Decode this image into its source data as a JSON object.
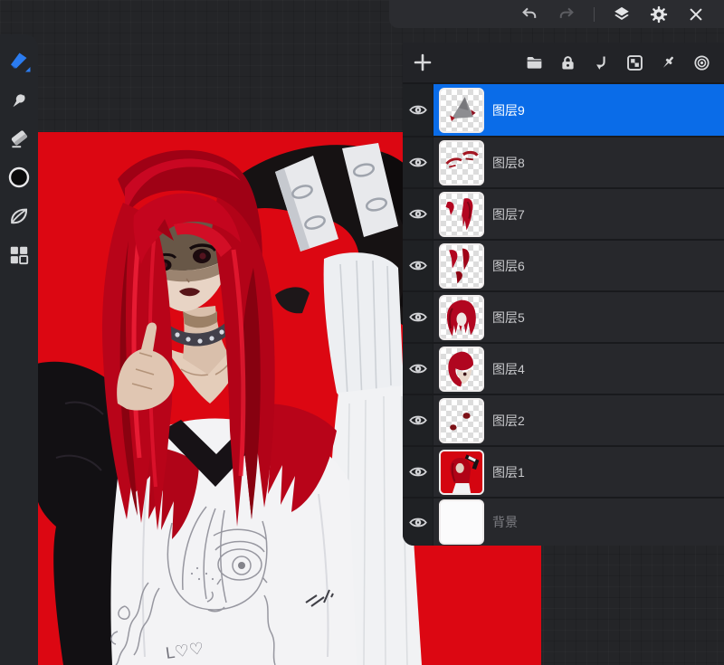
{
  "colors": {
    "accent_blue": "#0a6ce8",
    "canvas_red": "#dc0712",
    "panel_bg": "#232428",
    "row_bg": "#27282c",
    "current_color_swatch": "#0b0b0c"
  },
  "top_toolbar": {
    "items": [
      {
        "name": "undo",
        "icon": "undo",
        "enabled": true
      },
      {
        "name": "redo",
        "icon": "redo",
        "enabled": false
      },
      {
        "type": "separator"
      },
      {
        "name": "layers-toggle",
        "icon": "layers",
        "enabled": true
      },
      {
        "name": "settings",
        "icon": "gear",
        "enabled": true
      },
      {
        "name": "close",
        "icon": "close",
        "enabled": true
      }
    ]
  },
  "left_toolbar": {
    "tools": [
      {
        "name": "brush-tool",
        "icon": "brush",
        "selected": true
      },
      {
        "name": "smudge-tool",
        "icon": "smudge",
        "selected": false
      },
      {
        "name": "eraser-tool",
        "icon": "eraser",
        "selected": false
      },
      {
        "name": "color-swatch",
        "icon": "color-circle",
        "selected": false,
        "color": "#0b0b0c"
      },
      {
        "name": "leaf-tool",
        "icon": "leaf",
        "selected": false
      },
      {
        "name": "tools-grid",
        "icon": "grid",
        "selected": false
      }
    ]
  },
  "layers_panel": {
    "header": {
      "left_buttons": [
        {
          "name": "add-layer",
          "icon": "plus"
        }
      ],
      "right_buttons": [
        {
          "name": "group-folder",
          "icon": "folder"
        },
        {
          "name": "lock-layer",
          "icon": "lock"
        },
        {
          "name": "clipping-mask",
          "icon": "clip-arrow"
        },
        {
          "name": "alpha-lock",
          "icon": "checker"
        },
        {
          "name": "pin-layer",
          "icon": "pin"
        },
        {
          "name": "blend-options",
          "icon": "spiral"
        }
      ]
    },
    "layers": [
      {
        "label": "图层9",
        "selected": true,
        "visible": true,
        "thumb": "gray-cone"
      },
      {
        "label": "图层8",
        "selected": false,
        "visible": true,
        "thumb": "brows"
      },
      {
        "label": "图层7",
        "selected": false,
        "visible": true,
        "thumb": "strands"
      },
      {
        "label": "图层6",
        "selected": false,
        "visible": true,
        "thumb": "strand-pieces"
      },
      {
        "label": "图层5",
        "selected": false,
        "visible": true,
        "thumb": "wig-full"
      },
      {
        "label": "图层4",
        "selected": false,
        "visible": true,
        "thumb": "bob-hair"
      },
      {
        "label": "图层2",
        "selected": false,
        "visible": true,
        "thumb": "dots"
      },
      {
        "label": "图层1",
        "selected": false,
        "visible": true,
        "thumb": "artwork"
      },
      {
        "label": "背景",
        "selected": false,
        "visible": true,
        "thumb": "white",
        "dim_label": true
      }
    ]
  },
  "canvas": {
    "background_color": "#dc0712",
    "artwork": {
      "description": "anime girl with long crimson hair on red background, raised arm in black sleeve with white stripes, white shirt with pencil sketch doodle",
      "shirt_text": "L♡♡"
    }
  }
}
